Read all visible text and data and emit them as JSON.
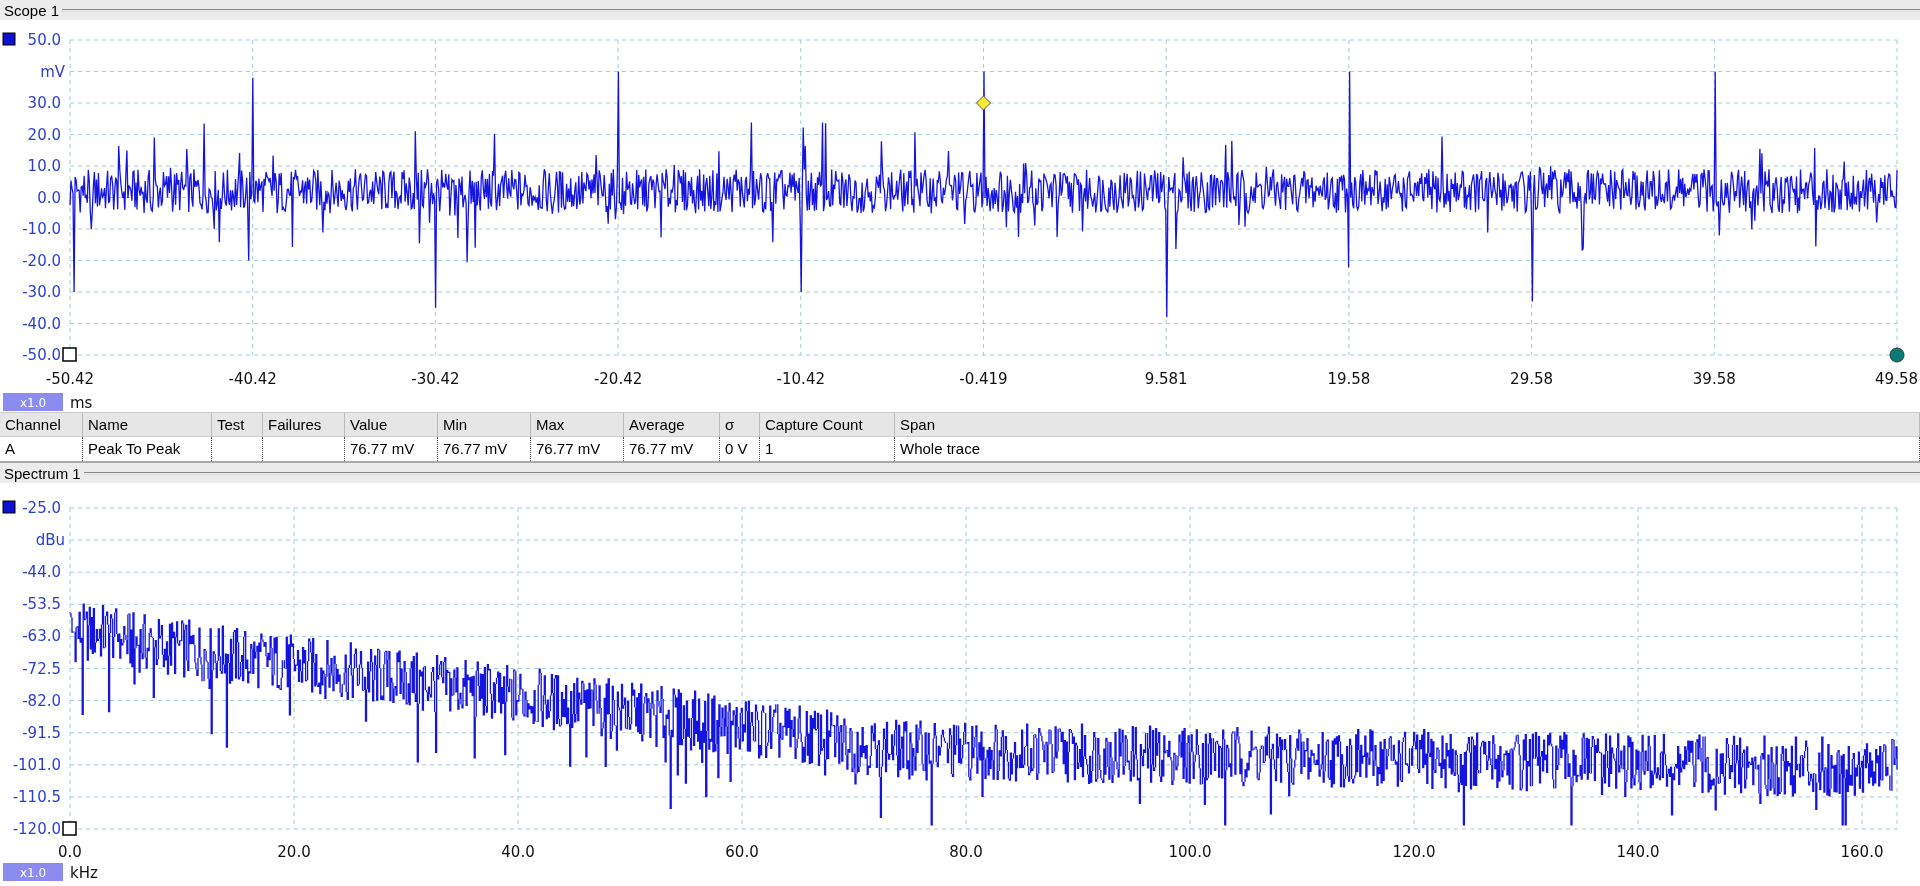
{
  "scope": {
    "title": "Scope 1",
    "y_labels": [
      "50.0",
      "30.0",
      "20.0",
      "10.0",
      "0.0",
      "-10.0",
      "-20.0",
      "-30.0",
      "-40.0",
      "-50.0"
    ],
    "y_unit": "mV",
    "x_labels": [
      "-50.42",
      "-40.42",
      "-30.42",
      "-20.42",
      "-10.42",
      "-0.419",
      "9.581",
      "19.58",
      "29.58",
      "39.58",
      "49.58"
    ],
    "zoom": "x1.0",
    "x_unit": "ms"
  },
  "measurements": {
    "columns": [
      "Channel",
      "Name",
      "Test",
      "Failures",
      "Value",
      "Min",
      "Max",
      "Average",
      "σ",
      "Capture Count",
      "Span"
    ],
    "rows": [
      {
        "cells": [
          "A",
          "Peak To Peak",
          "",
          "",
          "76.77 mV",
          "76.77 mV",
          "76.77 mV",
          "76.77 mV",
          "0 V",
          "1",
          "Whole trace"
        ]
      }
    ]
  },
  "spectrum": {
    "title": "Spectrum 1",
    "y_labels": [
      "-25.0",
      "-44.0",
      "-53.5",
      "-63.0",
      "-72.5",
      "-82.0",
      "-91.5",
      "-101.0",
      "-110.5",
      "-120.0"
    ],
    "y_unit": "dBu",
    "x_labels": [
      "0.0",
      "20.0",
      "40.0",
      "60.0",
      "80.0",
      "100.0",
      "120.0",
      "140.0",
      "160.0"
    ],
    "zoom": "x1.0",
    "x_unit": "kHz"
  }
}
